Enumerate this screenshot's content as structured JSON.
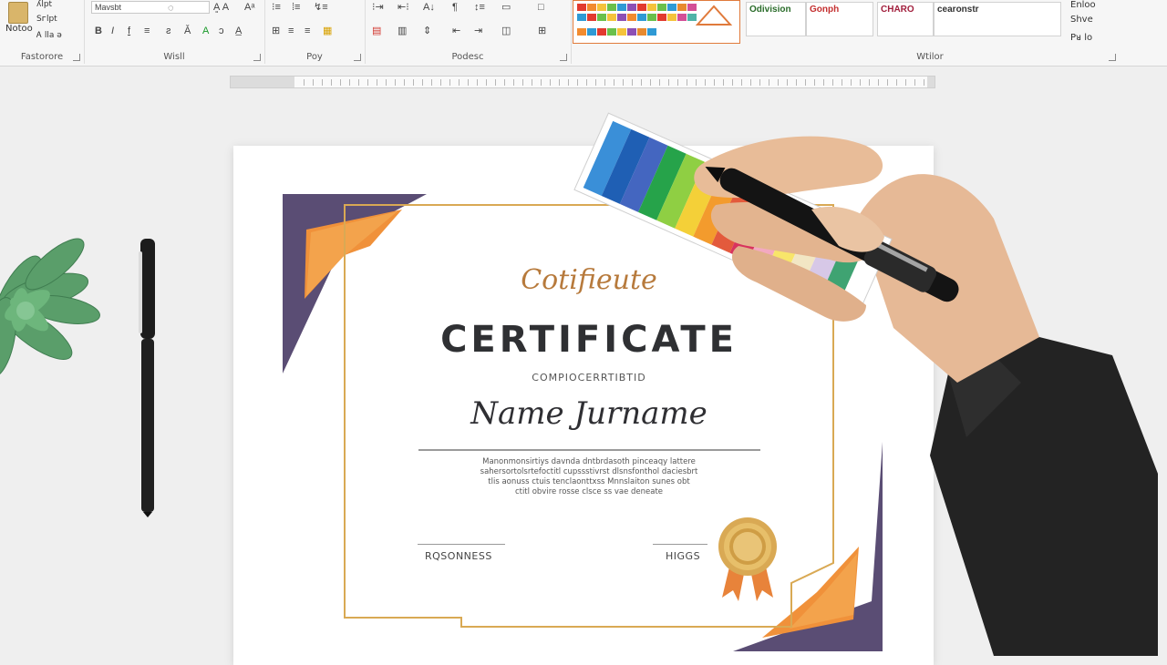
{
  "ribbon": {
    "clipboard": {
      "paste_label": "Notoo",
      "cut": "ʎlpt",
      "copy": "Sᴦlpt",
      "format": "Ꭺ lla ə",
      "group_label": "Fastorore"
    },
    "font": {
      "font_name": "Mavsbt",
      "group_label": "Wisll"
    },
    "paragraph": {
      "group_label": "Poy"
    },
    "styles": {
      "group_label": "Podesc"
    },
    "design": {
      "cards": [
        "Odivision",
        "Gonph",
        "CHARO",
        "cearonstr"
      ],
      "group_label": "Wtilor"
    },
    "editing": {
      "find": "Enloo",
      "replace": "Shve",
      "select": "Pᴚ lo"
    }
  },
  "certificate": {
    "script_title": "Cotifieute",
    "title": "CERTIFICATE",
    "subtitle": "COMPIOCERRTIBTID",
    "name": "Name Jurname",
    "body": "Manonmonsirtiys davnda dntbrdasoth pinceaqy lattere sahersortolsrtefoctitl cupssstivrst dlsnsfonthol daciesbrt tlis aonuss ctuis tenclaonttxss Mnnslaiton sunes obt ctitl obvire rosse clsce ss vae deneate",
    "left_signature": "RQSONNESS",
    "right_signature": "HIGGS"
  },
  "colors": {
    "accent_orange": "#f0913a",
    "accent_purple": "#5a4d74",
    "gold": "#d9a954",
    "text_dark": "#2f3033"
  }
}
